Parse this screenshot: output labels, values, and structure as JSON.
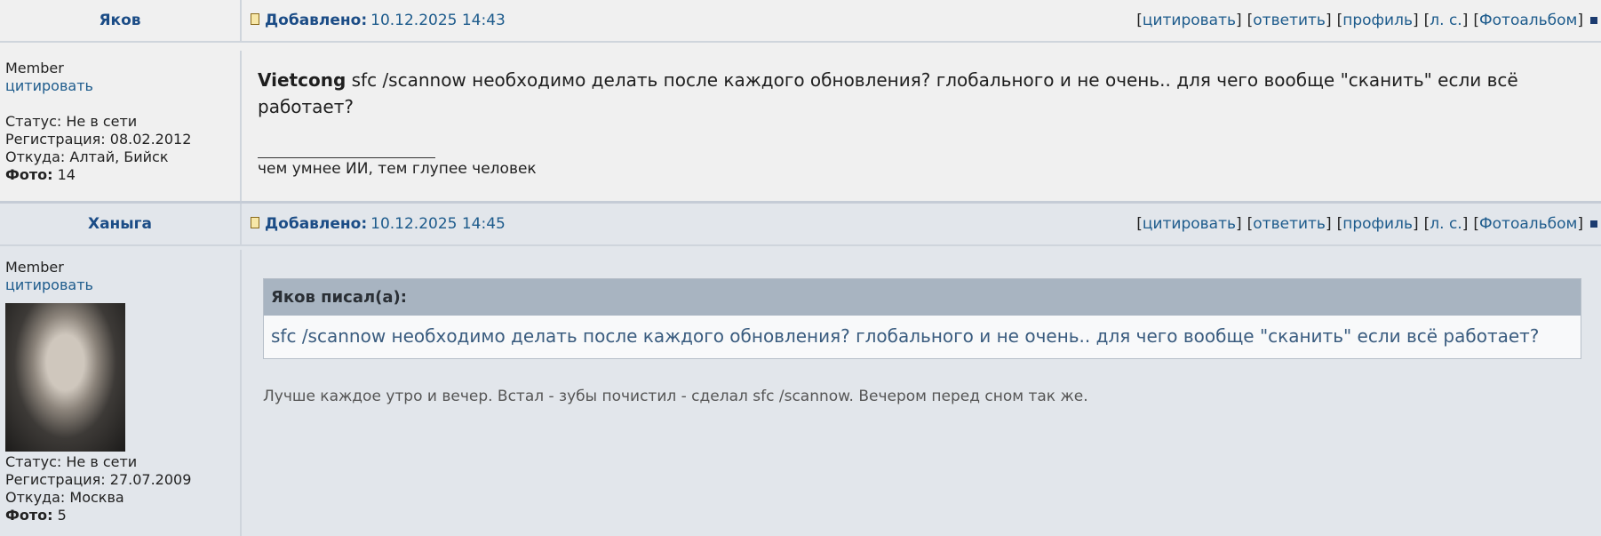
{
  "posts": [
    {
      "author": "Яков",
      "added_label": "Добавлено:",
      "added_date": "10.12.2025 14:43",
      "actions": [
        "цитировать",
        "ответить",
        "профиль",
        "л. с.",
        "Фотоальбом"
      ],
      "role": "Member",
      "quote_link": "цитировать",
      "status": "Статус: Не в сети",
      "registration": "Регистрация: 08.02.2012",
      "location": "Откуда: Алтай, Бийск",
      "photo_label": "Фото:",
      "photo_count": "14",
      "message_bold": "Vietcong",
      "message_text": " sfc /scannow необходимо делать после каждого обновления? глобального и не очень.. для чего вообще \"сканить\" если всё работает?",
      "signature": "чем умнее ИИ, тем глупее человек"
    },
    {
      "author": "Ханыга",
      "added_label": "Добавлено:",
      "added_date": "10.12.2025 14:45",
      "actions": [
        "цитировать",
        "ответить",
        "профиль",
        "л. с.",
        "Фотоальбом"
      ],
      "role": "Member",
      "quote_link": "цитировать",
      "status": "Статус: Не в сети",
      "registration": "Регистрация: 27.07.2009",
      "location": "Откуда: Москва",
      "photo_label": "Фото:",
      "photo_count": "5",
      "quote_author": "Яков писал(а):",
      "quote_text": "sfc /scannow необходимо делать после каждого обновления? глобального и не очень.. для чего вообще \"сканить\" если всё работает?",
      "reply_text": "Лучше каждое утро и вечер. Встал - зубы почистил - сделал sfc /scannow. Вечером перед сном так же."
    }
  ],
  "colors": {
    "link": "#1d5b8c",
    "header_name": "#1b4c86",
    "post1_bg": "#f0f0f0",
    "post2_bg": "#e2e6eb",
    "quote_header": "#a8b4c1"
  }
}
